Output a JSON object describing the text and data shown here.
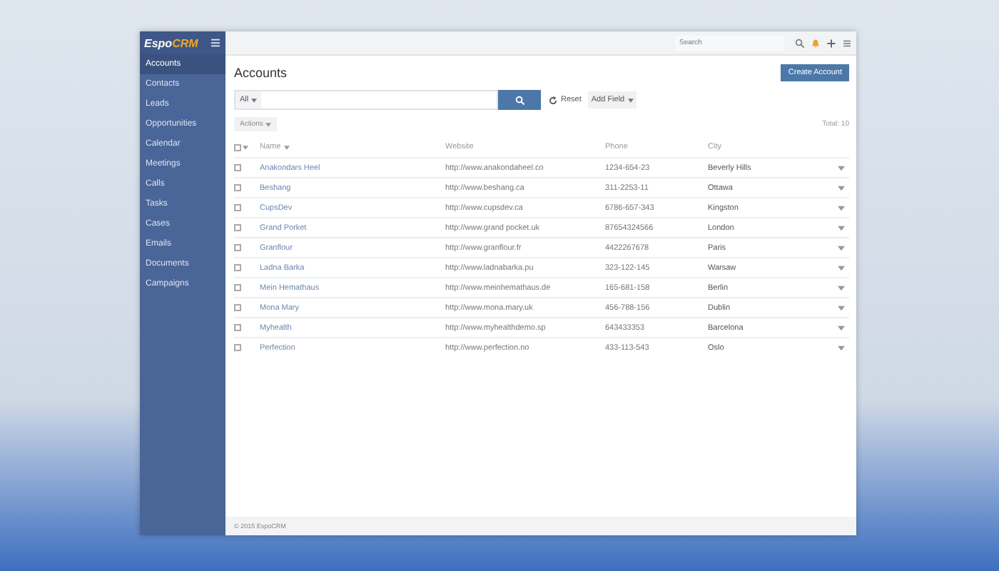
{
  "logo": {
    "espo": "Espo",
    "crm": "CRM"
  },
  "sidebar": {
    "items": [
      {
        "label": "Accounts",
        "selected": true
      },
      {
        "label": "Contacts",
        "selected": false
      },
      {
        "label": "Leads",
        "selected": false
      },
      {
        "label": "Opportunities",
        "selected": false
      },
      {
        "label": "Calendar",
        "selected": false
      },
      {
        "label": "Meetings",
        "selected": false
      },
      {
        "label": "Calls",
        "selected": false
      },
      {
        "label": "Tasks",
        "selected": false
      },
      {
        "label": "Cases",
        "selected": false
      },
      {
        "label": "Emails",
        "selected": false
      },
      {
        "label": "Documents",
        "selected": false
      },
      {
        "label": "Campaigns",
        "selected": false
      }
    ]
  },
  "topbar": {
    "search": {
      "placeholder": "Search"
    }
  },
  "page": {
    "title": "Accounts",
    "create_button": "Create Account"
  },
  "filter": {
    "scope": "All",
    "reset": "Reset",
    "add_field": "Add Field"
  },
  "actions": "Actions",
  "total": "Total: 10",
  "table": {
    "select_all": {
      "checked": false
    },
    "columns": [
      "Name",
      "Website",
      "Phone",
      "City"
    ],
    "rows": [
      {
        "checked": false,
        "name": "Anakondars Heel",
        "website": "http://www.anakondaheel.co",
        "phone": "1234-654-23",
        "city": "Beverly Hills"
      },
      {
        "checked": false,
        "name": "Beshang",
        "website": "http://www.beshang.ca",
        "phone": "311-2253-11",
        "city": "Ottawa"
      },
      {
        "checked": false,
        "name": "CupsDev",
        "website": "http://www.cupsdev.ca",
        "phone": "6786-657-343",
        "city": "Kingston"
      },
      {
        "checked": false,
        "name": "Grand Porket",
        "website": "http://www.grand pocket.uk",
        "phone": "87654324566",
        "city": "London"
      },
      {
        "checked": false,
        "name": "Granflour",
        "website": "http://www.granflour.fr",
        "phone": "4422267678",
        "city": "Paris"
      },
      {
        "checked": false,
        "name": "Ladna Barka",
        "website": "http://www.ladnabarka.pu",
        "phone": "323-122-145",
        "city": "Warsaw"
      },
      {
        "checked": false,
        "name": "Mein Hemathaus",
        "website": "http://www.meinhemathaus.de",
        "phone": "165-681-158",
        "city": "Berlin"
      },
      {
        "checked": false,
        "name": "Mona Mary",
        "website": "http://www.mona.mary.uk",
        "phone": "456-788-156",
        "city": "Dublin"
      },
      {
        "checked": false,
        "name": "Myhealth",
        "website": "http://www.myhealthdemo.sp",
        "phone": "643433353",
        "city": "Barcelona"
      },
      {
        "checked": false,
        "name": "Perfection",
        "website": "http://www.perfection.no",
        "phone": "433-113-543",
        "city": "Oslo"
      }
    ]
  },
  "footer": "© 2015 EspoCRM"
}
